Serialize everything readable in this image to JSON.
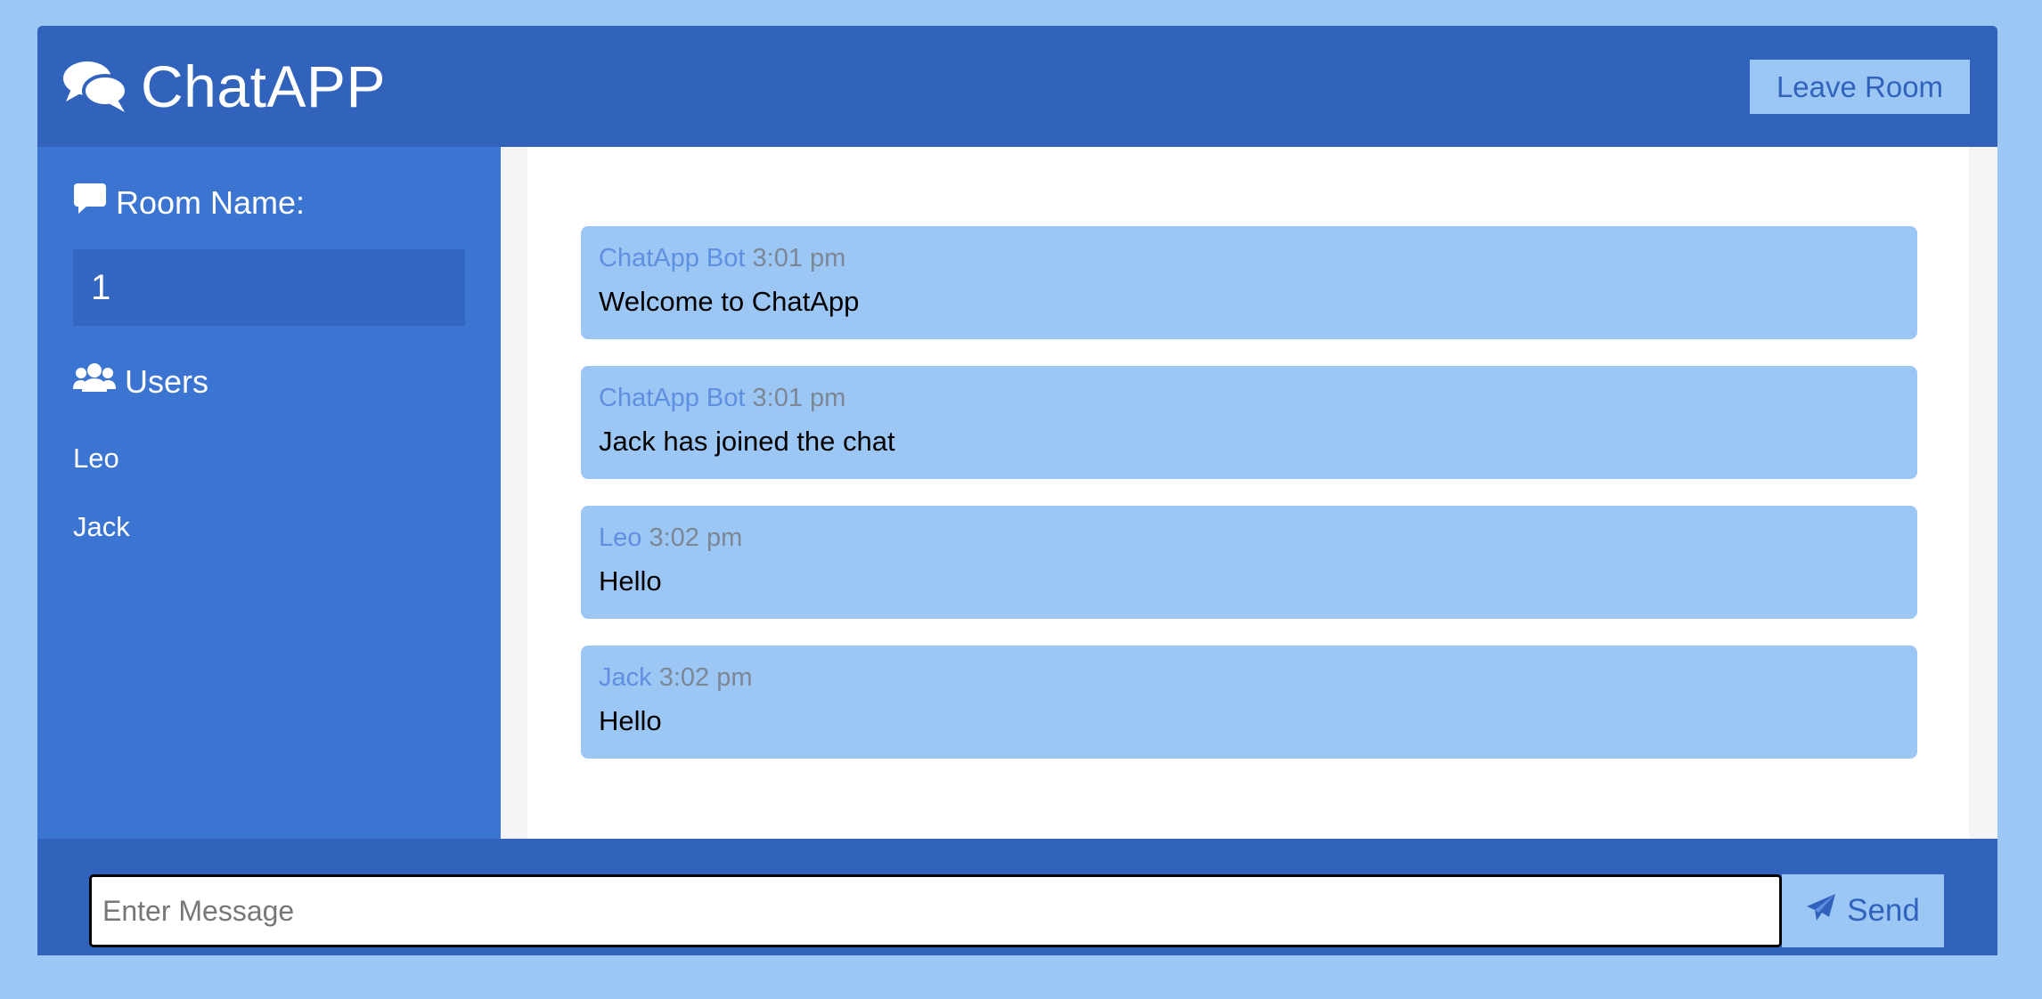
{
  "app": {
    "title": "ChatAPP"
  },
  "header": {
    "leave_label": "Leave Room"
  },
  "sidebar": {
    "room_heading": "Room Name:",
    "room_name": "1",
    "users_heading": "Users",
    "users": [
      "Leo",
      "Jack"
    ]
  },
  "messages": [
    {
      "author": "ChatApp Bot",
      "time": "3:01 pm",
      "text": "Welcome to ChatApp"
    },
    {
      "author": "ChatApp Bot",
      "time": "3:01 pm",
      "text": "Jack has joined the chat"
    },
    {
      "author": "Leo",
      "time": "3:02 pm",
      "text": "Hello"
    },
    {
      "author": "Jack",
      "time": "3:02 pm",
      "text": "Hello"
    }
  ],
  "composer": {
    "placeholder": "Enter Message",
    "send_label": "Send"
  },
  "colors": {
    "background": "#9cc7f4",
    "header": "#3163bd",
    "sidebar": "#3b75d1",
    "message_bubble": "#9cc7f4",
    "author": "#5f8fe0",
    "time": "#7c8796"
  },
  "icons": {
    "logo": "comments-icon",
    "room": "message-icon",
    "users": "users-icon",
    "send": "paper-plane-icon"
  }
}
